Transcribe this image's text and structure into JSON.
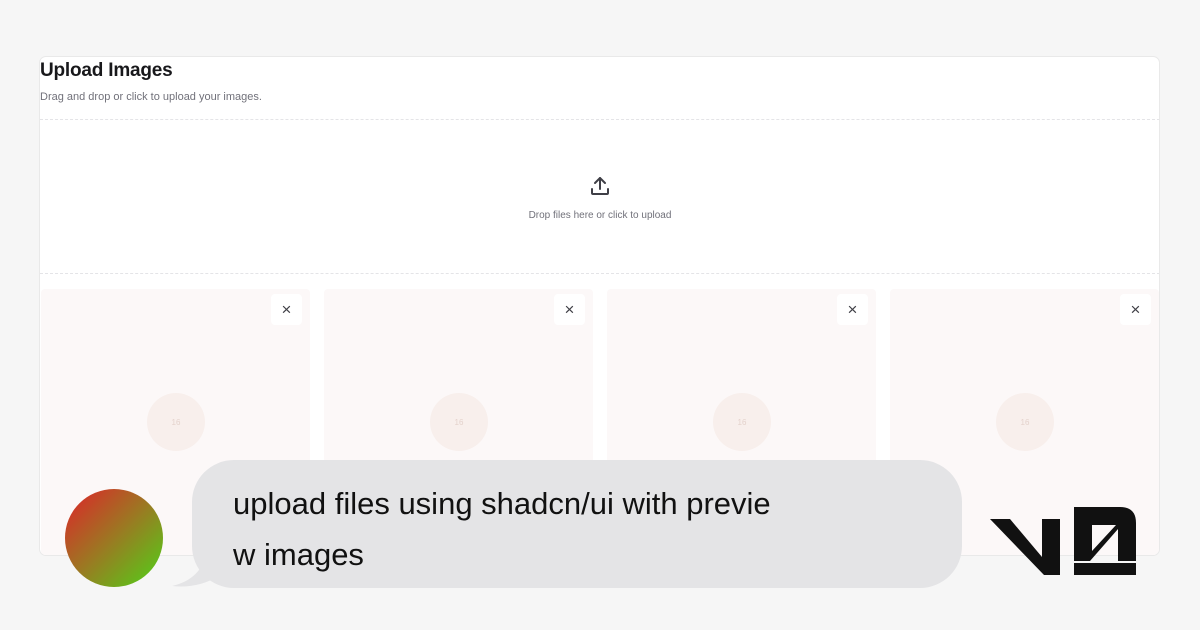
{
  "upload": {
    "title": "Upload Images",
    "subtitle": "Drag and drop or click to upload your images.",
    "dropzone_text": "Drop files here or click to upload",
    "upload_icon": "upload-icon",
    "previews": [
      {
        "remove_label": "×",
        "placeholder_text": "16"
      },
      {
        "remove_label": "×",
        "placeholder_text": "16"
      },
      {
        "remove_label": "×",
        "placeholder_text": "16"
      },
      {
        "remove_label": "×",
        "placeholder_text": "16"
      }
    ]
  },
  "chat": {
    "message": "upload files using shadcn/ui with previe\nw images"
  },
  "colors": {
    "avatar_gradient": [
      "#e0212a",
      "#4ed418"
    ],
    "bubble": "#e4e4e6",
    "logo": "#111111"
  }
}
